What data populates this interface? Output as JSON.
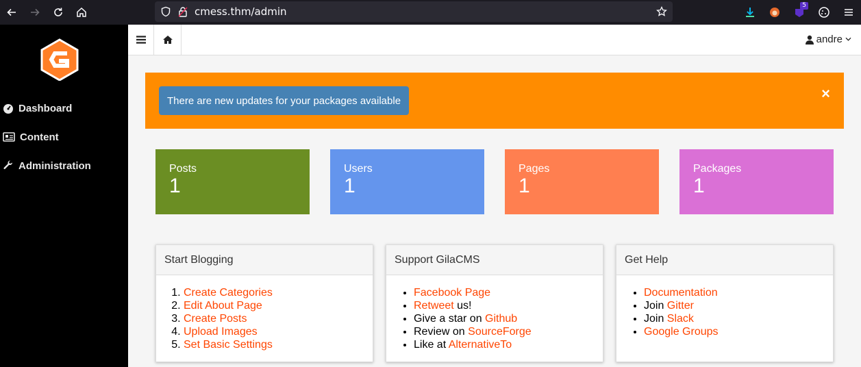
{
  "browser": {
    "url": "cmess.thm/admin",
    "badge_count": "5"
  },
  "sidebar": {
    "items": [
      {
        "label": "Dashboard",
        "icon": "dashboard-icon"
      },
      {
        "label": "Content",
        "icon": "content-icon"
      },
      {
        "label": "Administration",
        "icon": "wrench-icon"
      }
    ]
  },
  "header": {
    "user": "andre"
  },
  "alert": {
    "message": "There are new updates for your packages available",
    "close": "×"
  },
  "tiles": [
    {
      "label": "Posts",
      "value": "1",
      "color": "#6b8e23"
    },
    {
      "label": "Users",
      "value": "1",
      "color": "#6495ed"
    },
    {
      "label": "Pages",
      "value": "1",
      "color": "#ff7f50"
    },
    {
      "label": "Packages",
      "value": "1",
      "color": "#da70d6"
    }
  ],
  "panels": {
    "blogging": {
      "title": "Start Blogging",
      "items": [
        "Create Categories",
        "Edit About Page",
        "Create Posts",
        "Upload Images",
        "Set Basic Settings"
      ]
    },
    "support": {
      "title": "Support GilaCMS",
      "items": [
        {
          "pre": "",
          "link": "Facebook Page",
          "post": ""
        },
        {
          "pre": "",
          "link": "Retweet",
          "post": " us!"
        },
        {
          "pre": "Give a star on ",
          "link": "Github",
          "post": ""
        },
        {
          "pre": "Review on ",
          "link": "SourceForge",
          "post": ""
        },
        {
          "pre": "Like at ",
          "link": "AlternativeTo",
          "post": ""
        }
      ]
    },
    "help": {
      "title": "Get Help",
      "items": [
        {
          "pre": "",
          "link": "Documentation",
          "post": ""
        },
        {
          "pre": "Join ",
          "link": "Gitter",
          "post": ""
        },
        {
          "pre": "Join ",
          "link": "Slack",
          "post": ""
        },
        {
          "pre": "",
          "link": "Google Groups",
          "post": ""
        }
      ]
    }
  },
  "colors": {
    "accent": "#ff4500",
    "alert_bg": "#ff8c00",
    "alert_button": "#4682b4",
    "sidebar_bg": "#000000"
  }
}
